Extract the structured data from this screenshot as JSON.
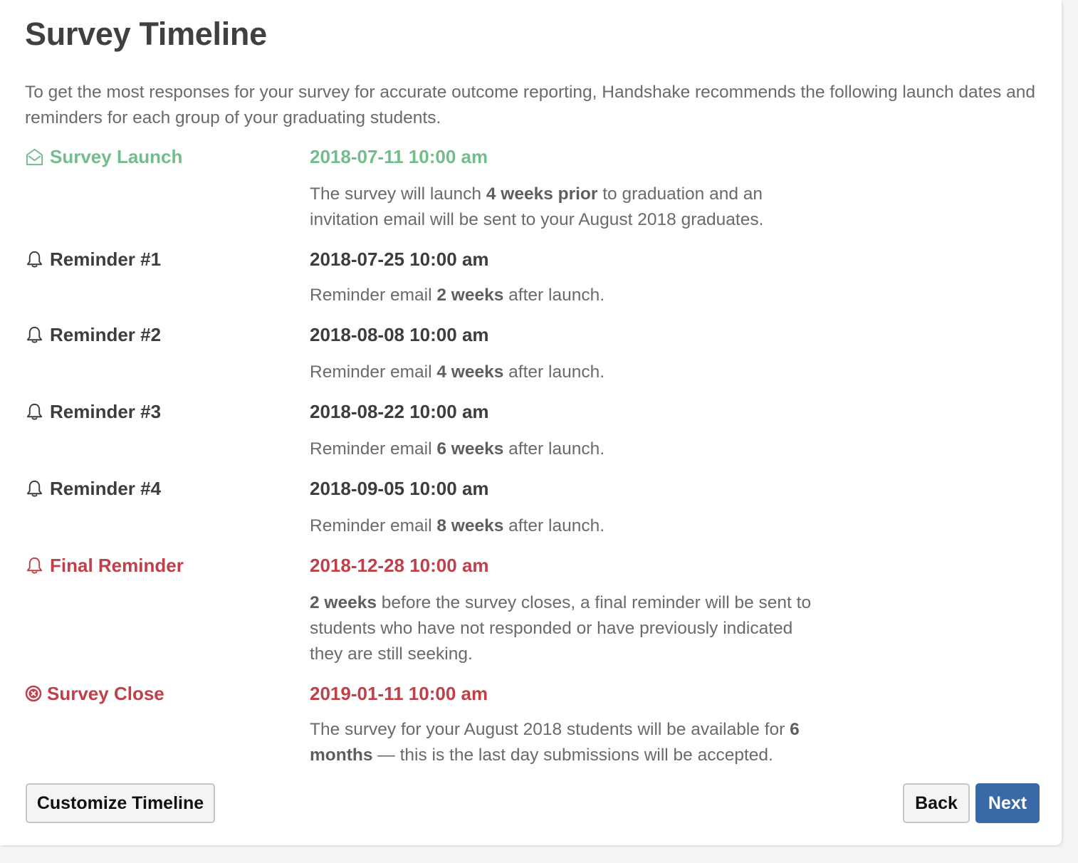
{
  "page": {
    "title": "Survey Timeline",
    "intro": "To get the most responses for your survey for accurate outcome reporting, Handshake recommends the following launch dates and reminders for each group of your graduating students."
  },
  "colors": {
    "launch": "#74bc8c",
    "reminder": "#3d3d3d",
    "final": "#c0404a",
    "primary_button": "#3a69a8"
  },
  "timeline": [
    {
      "icon": "envelope-open-icon",
      "label": "Survey Launch",
      "date": "2018-07-11 10:00 am",
      "desc": [
        {
          "t": "The survey will launch ",
          "b": false
        },
        {
          "t": "4 weeks prior",
          "b": true
        },
        {
          "t": " to graduation and an invitation email will be sent to your August 2018 graduates.",
          "b": false
        }
      ]
    },
    {
      "icon": "bell-icon",
      "label": "Reminder #1",
      "date": "2018-07-25 10:00 am",
      "desc": [
        {
          "t": "Reminder email ",
          "b": false
        },
        {
          "t": "2 weeks",
          "b": true
        },
        {
          "t": " after launch.",
          "b": false
        }
      ]
    },
    {
      "icon": "bell-icon",
      "label": "Reminder #2",
      "date": "2018-08-08 10:00 am",
      "desc": [
        {
          "t": "Reminder email ",
          "b": false
        },
        {
          "t": "4 weeks",
          "b": true
        },
        {
          "t": " after launch.",
          "b": false
        }
      ]
    },
    {
      "icon": "bell-icon",
      "label": "Reminder #3",
      "date": "2018-08-22 10:00 am",
      "desc": [
        {
          "t": "Reminder email ",
          "b": false
        },
        {
          "t": "6 weeks",
          "b": true
        },
        {
          "t": " after launch.",
          "b": false
        }
      ]
    },
    {
      "icon": "bell-icon",
      "label": "Reminder #4",
      "date": "2018-09-05 10:00 am",
      "desc": [
        {
          "t": "Reminder email ",
          "b": false
        },
        {
          "t": "8 weeks",
          "b": true
        },
        {
          "t": " after launch.",
          "b": false
        }
      ]
    },
    {
      "icon": "bell-icon",
      "label": "Final Reminder",
      "date": "2018-12-28 10:00 am",
      "desc": [
        {
          "t": "2 weeks",
          "b": true
        },
        {
          "t": " before the survey closes, a final reminder will be sent to students who have not responded or have previously indicated they are still seeking.",
          "b": false
        }
      ]
    },
    {
      "icon": "times-circle-icon",
      "label": "Survey Close",
      "date": "2019-01-11 10:00 am",
      "desc": [
        {
          "t": "The survey for your August 2018 students will be available for ",
          "b": false
        },
        {
          "t": "6 months",
          "b": true
        },
        {
          "t": " — this is the last day submissions will be accepted.",
          "b": false
        }
      ]
    }
  ],
  "buttons": {
    "customize": "Customize Timeline",
    "back": "Back",
    "next": "Next"
  }
}
